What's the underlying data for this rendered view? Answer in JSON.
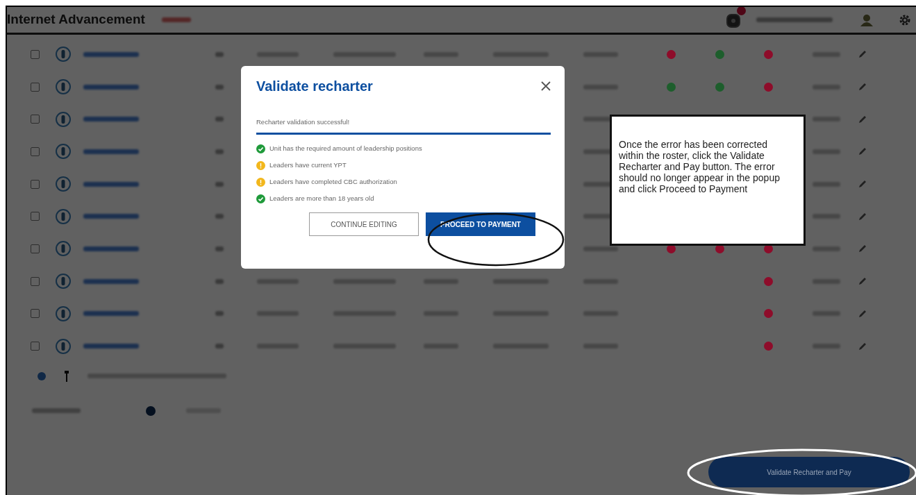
{
  "header": {
    "title": "Internet Advancement"
  },
  "roster": {
    "rows": [
      {
        "checked": false,
        "statuses": [
          {
            "kind": "dot",
            "color": "#8e0c2a"
          },
          {
            "kind": "dot",
            "color": "#1d5e2c"
          },
          {
            "kind": "dot",
            "color": "#8e0c2a"
          }
        ]
      },
      {
        "checked": false,
        "statuses": [
          {
            "kind": "dot",
            "color": "#1d5e2c"
          },
          {
            "kind": "dot",
            "color": "#1d5e2c"
          },
          {
            "kind": "dot",
            "color": "#8e0c2a"
          }
        ]
      },
      {
        "checked": false,
        "statuses": [
          {
            "kind": "blank"
          },
          {
            "kind": "blank"
          },
          {
            "kind": "blank"
          }
        ]
      },
      {
        "checked": false,
        "statuses": [
          {
            "kind": "blank"
          },
          {
            "kind": "blank"
          },
          {
            "kind": "blank"
          }
        ]
      },
      {
        "checked": false,
        "statuses": [
          {
            "kind": "blank"
          },
          {
            "kind": "blank"
          },
          {
            "kind": "blank"
          }
        ]
      },
      {
        "checked": false,
        "statuses": [
          {
            "kind": "blank"
          },
          {
            "kind": "blank"
          },
          {
            "kind": "blank"
          }
        ]
      },
      {
        "checked": false,
        "statuses": [
          {
            "kind": "dot",
            "color": "#8e0c2a"
          },
          {
            "kind": "dot",
            "color": "#8e0c2a"
          },
          {
            "kind": "dot",
            "color": "#8e0c2a"
          }
        ]
      },
      {
        "checked": false,
        "statuses": [
          {
            "kind": "blank"
          },
          {
            "kind": "blank"
          },
          {
            "kind": "dot",
            "color": "#8e0c2a"
          }
        ]
      },
      {
        "checked": false,
        "statuses": [
          {
            "kind": "blank"
          },
          {
            "kind": "blank"
          },
          {
            "kind": "dot",
            "color": "#8e0c2a"
          }
        ]
      },
      {
        "checked": false,
        "statuses": [
          {
            "kind": "blank"
          },
          {
            "kind": "blank"
          },
          {
            "kind": "dot",
            "color": "#8e0c2a"
          }
        ]
      }
    ]
  },
  "footer_button": {
    "label": "Validate Recharter and Pay"
  },
  "modal": {
    "title": "Validate recharter",
    "status_message": "Recharter validation successful!",
    "progress": {
      "level": 1
    },
    "checks": [
      {
        "kind": "pass",
        "text": "Unit has the required amount of leadership positions"
      },
      {
        "kind": "warning",
        "text": "Leaders have current YPT"
      },
      {
        "kind": "warning",
        "text": "Leaders have completed CBC authorization"
      },
      {
        "kind": "pass",
        "text": "Leaders are more than 18 years old"
      }
    ],
    "buttons": [
      {
        "kind": "secondary",
        "label": "CONTINUE EDITING"
      },
      {
        "kind": "primary",
        "label": "PROCEED TO PAYMENT"
      }
    ]
  },
  "callout": {
    "text": "Once the error has been corrected within the roster, click the Validate Recharter and Pay button. The error should no longer appear in the popup and click Proceed to Payment"
  }
}
